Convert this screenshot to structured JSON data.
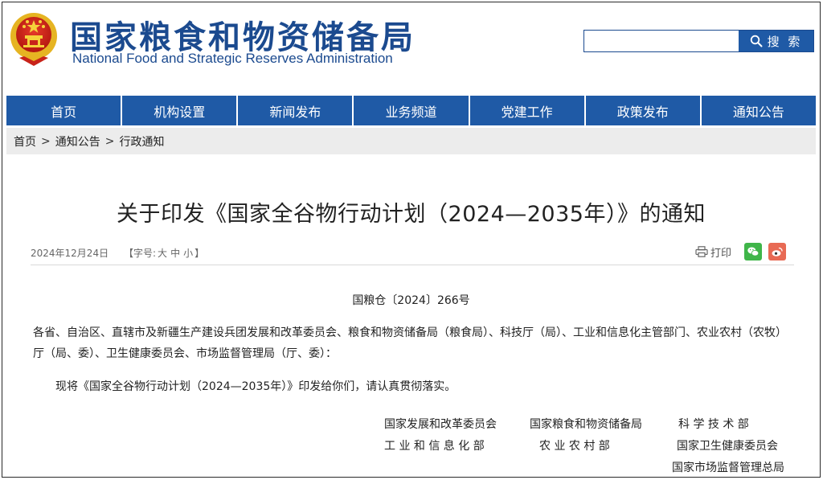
{
  "header": {
    "title_cn": "国家粮食和物资储备局",
    "title_en": "National Food and Strategic Reserves Administration",
    "search": {
      "placeholder": "",
      "button_label": "搜 索"
    }
  },
  "colors": {
    "brand_blue": "#1f5aa6",
    "title_blue": "#1b4a8f",
    "wechat_green": "#3fb549",
    "weibo_red": "#e86a54"
  },
  "nav": {
    "items": [
      "首页",
      "机构设置",
      "新闻发布",
      "业务频道",
      "党建工作",
      "政策发布",
      "通知公告"
    ]
  },
  "breadcrumb": {
    "items": [
      "首页",
      "通知公告",
      "行政通知"
    ],
    "separator": ">"
  },
  "article": {
    "title": "关于印发《国家全谷物行动计划（2024—2035年）》的通知",
    "date": "2024年12月24日",
    "font_size_prefix": "【字号:",
    "font_sizes": [
      "大",
      "中",
      "小"
    ],
    "font_size_suffix": "】",
    "print_label": "打印",
    "doc_number": "国粮仓〔2024〕266号",
    "addressee": "各省、自治区、直辖市及新疆生产建设兵团发展和改革委员会、粮食和物资储备局（粮食局）、科技厅（局）、工业和信息化主管部门、农业农村（农牧）厅（局、委）、卫生健康委员会、市场监督管理局（厅、委）：",
    "body": "现将《国家全谷物行动计划（2024—2035年）》印发给你们，请认真贯彻落实。",
    "signatories": [
      "国家发展和改革委员会",
      "国家粮食和物资储备局",
      "科 学 技 术 部",
      "工 业 和 信 息 化 部",
      "农 业 农 村 部",
      "国家卫生健康委员会",
      "国家市场监督管理总局"
    ]
  }
}
